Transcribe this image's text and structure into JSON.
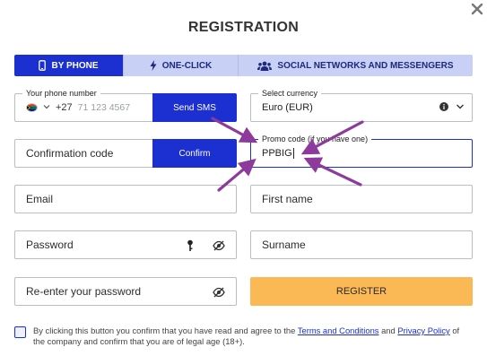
{
  "dialog": {
    "title": "REGISTRATION",
    "close_icon": "close-icon"
  },
  "tabs": [
    {
      "label": "BY PHONE",
      "icon": "phone-icon",
      "active": true
    },
    {
      "label": "ONE-CLICK",
      "icon": "lightning-icon",
      "active": false
    },
    {
      "label": "SOCIAL NETWORKS AND MESSENGERS",
      "icon": "users-icon",
      "active": false
    }
  ],
  "phone": {
    "label": "Your phone number",
    "country_code": "+27",
    "placeholder": "71 123 4567",
    "send_button": "Send SMS"
  },
  "currency": {
    "label": "Select currency",
    "value": "Euro (EUR)"
  },
  "confirmation": {
    "placeholder": "Confirmation code",
    "button": "Confirm"
  },
  "promo": {
    "label": "Promo code (if you have one)",
    "value": "PPBIG"
  },
  "email": {
    "placeholder": "Email"
  },
  "first_name": {
    "placeholder": "First name"
  },
  "password": {
    "placeholder": "Password"
  },
  "surname": {
    "placeholder": "Surname"
  },
  "repeat_password": {
    "placeholder": "Re-enter your password"
  },
  "register_button": "REGISTER",
  "agreement": {
    "text_1": "By clicking this button you confirm that you have read and agree to the",
    "link_terms": "Terms and Conditions",
    "text_2": "and",
    "link_privacy": "Privacy Policy",
    "text_3": "of the company and confirm that you are of legal age (18+)."
  },
  "colors": {
    "primary": "#1c2fd0",
    "tab_inactive": "#c8d0f6",
    "register": "#fbb955",
    "annotation_arrows": "#8e3a9c"
  }
}
